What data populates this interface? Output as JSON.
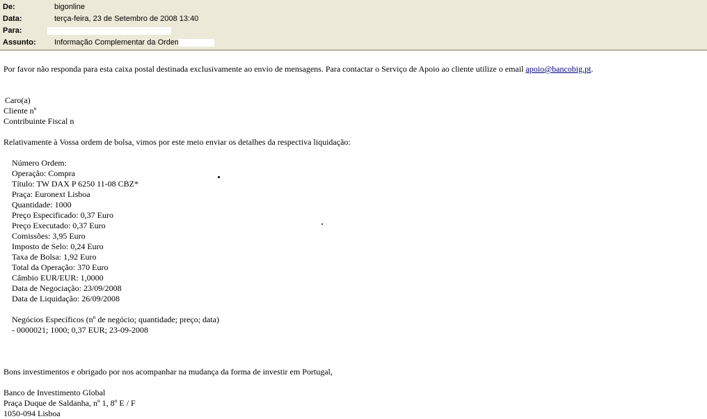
{
  "header": {
    "from_label": "De:",
    "from_value": "bigonline",
    "date_label": "Data:",
    "date_value": "terça-feira, 23 de Setembro de 2008 13:40",
    "to_label": "Para:",
    "to_value": "",
    "subject_label": "Assunto:",
    "subject_value": "Informação Complementar da Ordem"
  },
  "body": {
    "notice_text": "Por favor não responda para esta caixa postal destinada exclusivamente ao envio de mensagens. Para contactar o Serviço de Apoio ao cliente utilize o email",
    "notice_email": "apoio@bancobig.pt",
    "notice_end": ".",
    "greeting": "Caro(a)",
    "client_no": "Cliente nº",
    "tax_no": "Contribuinte Fiscal n",
    "intro": "Relativamente à Vossa ordem de bolsa, vimos por este meio enviar os detalhes da respectiva liquidação:",
    "details": [
      "Número Ordem:",
      "Operação: Compra",
      "Título: TW DAX P 6250 11-08 CBZ*",
      "Praça: Euronext Lisboa",
      "Quantidade: 1000",
      "Preço Especificado: 0,37 Euro",
      "Preço Executado: 0,37 Euro",
      "Comissões: 3,95 Euro",
      "Imposto de Selo: 0,24 Euro",
      "Taxa de Bolsa: 1,92 Euro",
      "Total da Operação: 370 Euro",
      "Câmbio EUR/EUR: 1,0000",
      "Data de Negociação: 23/09/2008",
      "Data de Liquidação: 26/09/2008"
    ],
    "deals_header": "Negócios Específicos (nº de negócio; quantidade; preço; data)",
    "deals_line": "- 0000021; 1000; 0,37 EUR; 23-09-2008",
    "closing": "Bons investimentos e obrigado por nos acompanhar na mudança da forma de investir em Portugal,",
    "signature": [
      "Banco de Investimento Global",
      "Praça Duque de Saldanha, nº 1, 8º E / F",
      "1050-094 Lisboa"
    ]
  }
}
